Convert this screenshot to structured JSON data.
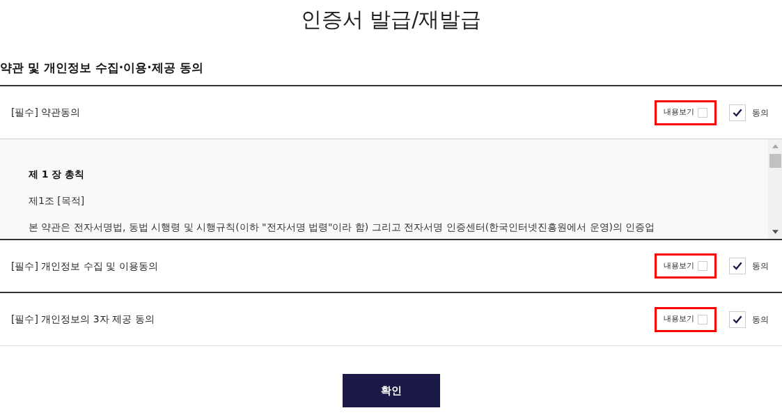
{
  "title": "인증서 발급/재발급",
  "section_heading": "약관 및 개인정보 수집·이용·제공 동의",
  "agreements": [
    {
      "label": "[필수] 약관동의",
      "view": {
        "label": "내용보기",
        "checked": false
      },
      "agree": {
        "label": "동의",
        "checked": true
      },
      "highlighted": true,
      "terms": {
        "heading": "제 1 장 총칙",
        "paragraphs": [
          "제1조 [목적]",
          "본 약관은 전자서명법, 동법 시행령 및 시행규칙(이하 \"전자서명 법령\"이라 함) 그리고 전자서명 인증센터(한국인터넷진흥원에서 운영)의 인증업"
        ]
      }
    },
    {
      "label": "[필수] 개인정보 수집 및 이용동의",
      "view": {
        "label": "내용보기",
        "checked": false
      },
      "agree": {
        "label": "동의",
        "checked": true
      },
      "highlighted": true
    },
    {
      "label": "[필수] 개인정보의 3자 제공 동의",
      "view": {
        "label": "내용보기",
        "checked": false
      },
      "agree": {
        "label": "동의",
        "checked": true
      },
      "highlighted": true
    }
  ],
  "confirm_button": "확인"
}
